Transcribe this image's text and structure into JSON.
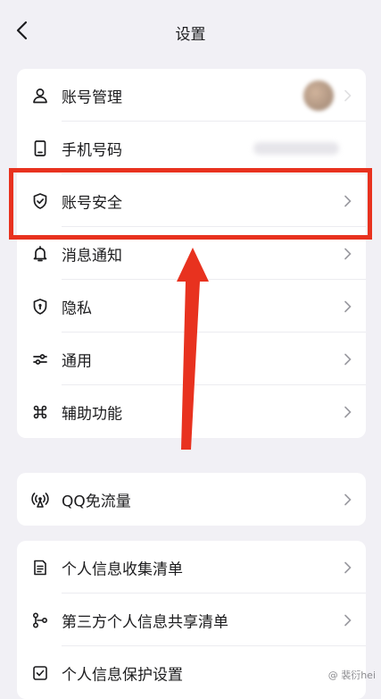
{
  "header": {
    "title": "设置",
    "back_icon": "chevron-left-icon"
  },
  "group1": {
    "items": [
      {
        "label": "账号管理",
        "icon": "user-icon"
      },
      {
        "label": "手机号码",
        "icon": "phone-icon"
      },
      {
        "label": "账号安全",
        "icon": "shield-check-icon"
      },
      {
        "label": "消息通知",
        "icon": "bell-icon"
      },
      {
        "label": "隐私",
        "icon": "shield-keyhole-icon"
      },
      {
        "label": "通用",
        "icon": "sliders-icon"
      },
      {
        "label": "辅助功能",
        "icon": "command-icon"
      }
    ]
  },
  "group2": {
    "items": [
      {
        "label": "QQ免流量",
        "icon": "broadcast-icon"
      }
    ]
  },
  "group3": {
    "items": [
      {
        "label": "个人信息收集清单",
        "icon": "document-list-icon"
      },
      {
        "label": "第三方个人信息共享清单",
        "icon": "share-nodes-icon"
      },
      {
        "label": "个人信息保护设置",
        "icon": "checkbox-icon"
      }
    ]
  },
  "annotation": {
    "highlight_color": "#e8321f"
  },
  "watermark": {
    "text": "@ 裴衍hei"
  }
}
